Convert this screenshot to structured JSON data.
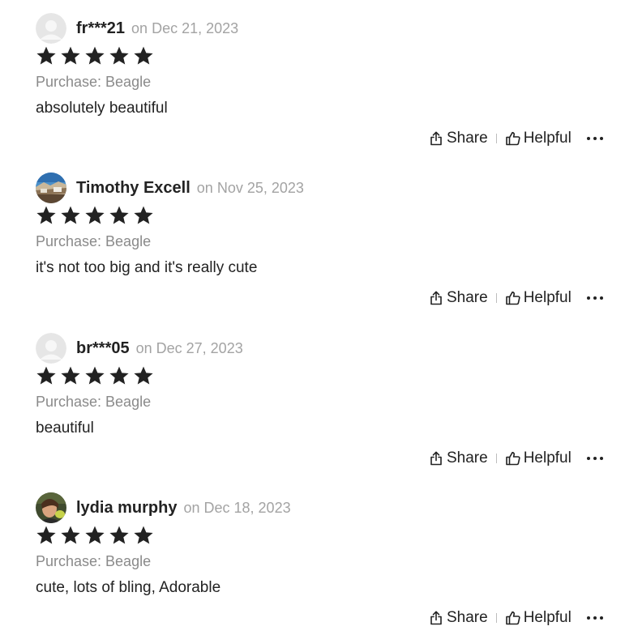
{
  "colors": {
    "text": "#222222",
    "date": "#a3a3a3",
    "purchase": "#8a8a8a",
    "star": "#222222",
    "default_avatar_bg": "#e6e6e6"
  },
  "reviews": [
    {
      "name": "fr***21",
      "date": "on Dec 21, 2023",
      "rating": 5,
      "purchase": "Purchase: Beagle",
      "text": "absolutely beautiful",
      "avatar": "default-avatar-icon",
      "share_label": "Share",
      "helpful_label": "Helpful"
    },
    {
      "name": "Timothy Excell",
      "date": "on Nov 25, 2023",
      "rating": 5,
      "purchase": "Purchase: Beagle",
      "text": "it's not too big and it's really cute",
      "avatar": "landscape-photo-avatar",
      "share_label": "Share",
      "helpful_label": "Helpful"
    },
    {
      "name": "br***05",
      "date": "on Dec 27, 2023",
      "rating": 5,
      "purchase": "Purchase: Beagle",
      "text": "beautiful",
      "avatar": "default-avatar-icon",
      "share_label": "Share",
      "helpful_label": "Helpful"
    },
    {
      "name": "lydia murphy",
      "date": "on Dec 18, 2023",
      "rating": 5,
      "purchase": "Purchase: Beagle",
      "text": "cute, lots of bling, Adorable",
      "avatar": "person-photo-avatar",
      "share_label": "Share",
      "helpful_label": "Helpful"
    }
  ]
}
